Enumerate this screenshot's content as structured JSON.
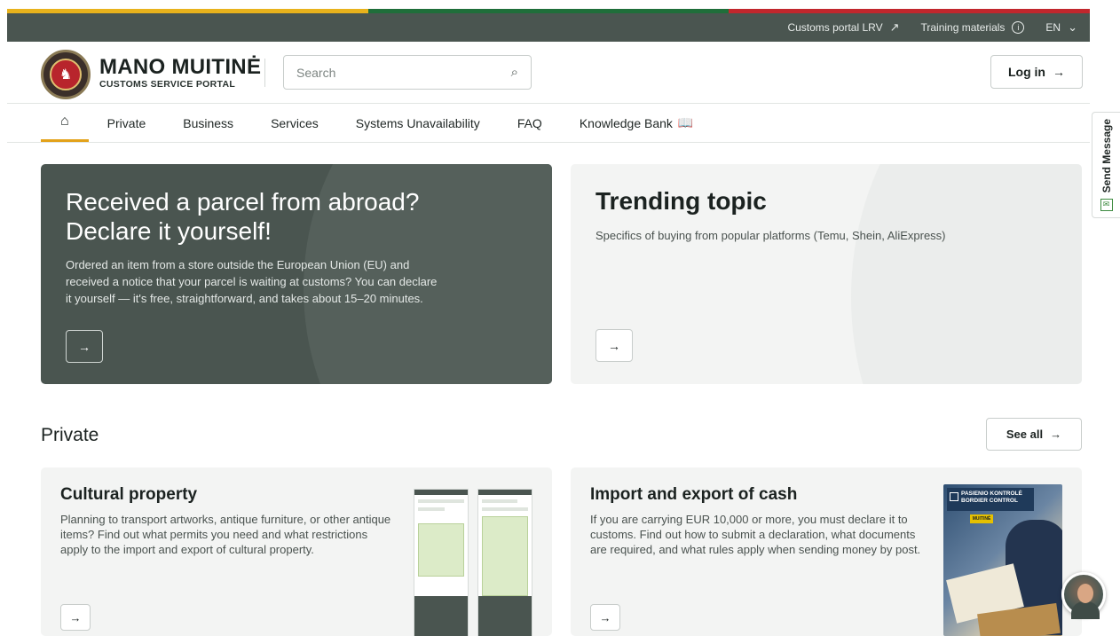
{
  "flag_colors": [
    "#e8b21c",
    "#1f6e3a",
    "#c1272d"
  ],
  "topbar": {
    "links": [
      {
        "label": "Customs portal LRV",
        "icon": "external-arrow-icon"
      },
      {
        "label": "Training materials",
        "icon": "info-icon"
      },
      {
        "label": "EN",
        "icon": "chevron-down-icon"
      }
    ]
  },
  "brand": {
    "name": "MANO MUITINĖ",
    "subtitle": "CUSTOMS SERVICE PORTAL",
    "emblem": "customs-emblem-logo"
  },
  "search": {
    "placeholder": "Search",
    "icon": "search-icon"
  },
  "header": {
    "login_label": "Log in",
    "login_icon": "arrow-right-icon"
  },
  "nav": {
    "home_icon": "home-icon",
    "items": [
      "Private",
      "Business",
      "Services",
      "Systems Unavailability",
      "FAQ",
      "Knowledge Bank"
    ],
    "knowledge_icon": "book-icon"
  },
  "send_message": {
    "label": "Send Message",
    "icon": "envelope-icon"
  },
  "hero": {
    "title": "Received a parcel from abroad? Declare it yourself!",
    "text": "Ordered an item from a store outside the European Union (EU) and received a notice that your parcel is waiting at customs? You can declare it yourself — it's free, straightforward, and takes about 15–20 minutes."
  },
  "trending": {
    "title": "Trending topic",
    "text": "Specifics of buying from popular platforms (Temu, Shein, AliExpress)"
  },
  "private_section": {
    "title": "Private",
    "see_all": "See all",
    "cards": [
      {
        "title": "Cultural property",
        "text": "Planning to transport artworks, antique furniture, or other antique items? Find out what permits you need and what restrictions apply to the import and export of cultural property."
      },
      {
        "title": "Import and export of cash",
        "text": "If you are carrying EUR 10,000 or more, you must declare it to customs. Find out how to submit a declaration, what documents are required, and what rules apply when sending money by post.",
        "image_sign_line1": "PASIENIO KONTROLĖ",
        "image_sign_line2": "BORDIER CONTROL",
        "image_tag": "MUITINĖ"
      }
    ]
  },
  "arrow_glyph": "→",
  "chat": {
    "icon": "chat-assistant-avatar"
  }
}
